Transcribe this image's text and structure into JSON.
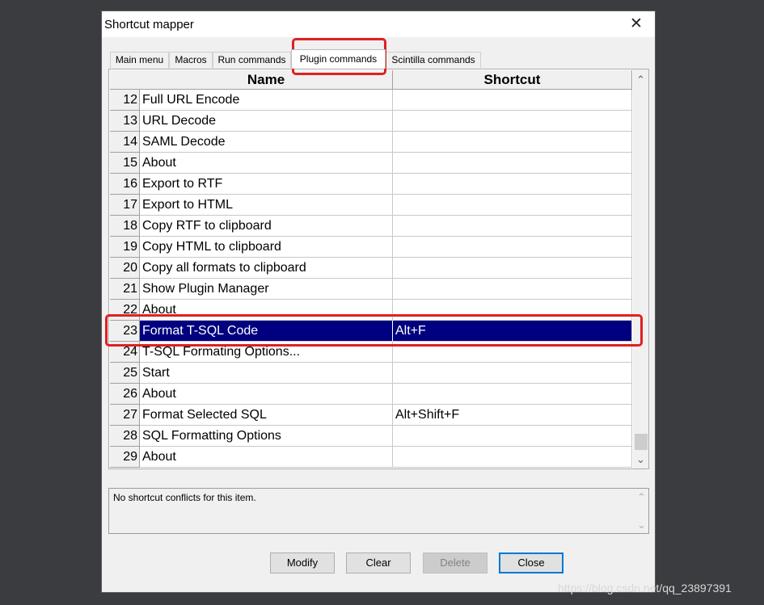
{
  "window": {
    "title": "Shortcut mapper",
    "close_glyph": "✕"
  },
  "tabs": [
    {
      "label": "Main menu",
      "active": false
    },
    {
      "label": "Macros",
      "active": false
    },
    {
      "label": "Run commands",
      "active": false
    },
    {
      "label": "Plugin commands",
      "active": true
    },
    {
      "label": "Scintilla commands",
      "active": false
    }
  ],
  "grid": {
    "headers": {
      "name": "Name",
      "shortcut": "Shortcut"
    },
    "rows": [
      {
        "num": "12",
        "name": "Full URL Encode",
        "shortcut": ""
      },
      {
        "num": "13",
        "name": "URL Decode",
        "shortcut": ""
      },
      {
        "num": "14",
        "name": "SAML Decode",
        "shortcut": ""
      },
      {
        "num": "15",
        "name": "About",
        "shortcut": ""
      },
      {
        "num": "16",
        "name": "Export to RTF",
        "shortcut": ""
      },
      {
        "num": "17",
        "name": "Export to HTML",
        "shortcut": ""
      },
      {
        "num": "18",
        "name": "Copy RTF to clipboard",
        "shortcut": ""
      },
      {
        "num": "19",
        "name": "Copy HTML to clipboard",
        "shortcut": ""
      },
      {
        "num": "20",
        "name": "Copy all formats to clipboard",
        "shortcut": ""
      },
      {
        "num": "21",
        "name": "Show Plugin Manager",
        "shortcut": ""
      },
      {
        "num": "22",
        "name": "About",
        "shortcut": ""
      },
      {
        "num": "23",
        "name": "Format T-SQL Code",
        "shortcut": "Alt+F",
        "selected": true
      },
      {
        "num": "24",
        "name": "T-SQL Formating Options...",
        "shortcut": ""
      },
      {
        "num": "25",
        "name": "Start",
        "shortcut": ""
      },
      {
        "num": "26",
        "name": "About",
        "shortcut": ""
      },
      {
        "num": "27",
        "name": "Format Selected SQL",
        "shortcut": "Alt+Shift+F"
      },
      {
        "num": "28",
        "name": "SQL Formatting Options",
        "shortcut": ""
      },
      {
        "num": "29",
        "name": "About",
        "shortcut": ""
      }
    ],
    "scroll_up_glyph": "⌃",
    "scroll_down_glyph": "⌄"
  },
  "conflict": {
    "text": "No shortcut conflicts for this item."
  },
  "buttons": {
    "modify": "Modify",
    "clear": "Clear",
    "delete": "Delete",
    "close": "Close"
  },
  "watermark": "https://blog.csdn.net/qq_23897391",
  "colors": {
    "selection": "#000080",
    "annotation": "#e02020",
    "default_button_border": "#0078d7"
  }
}
